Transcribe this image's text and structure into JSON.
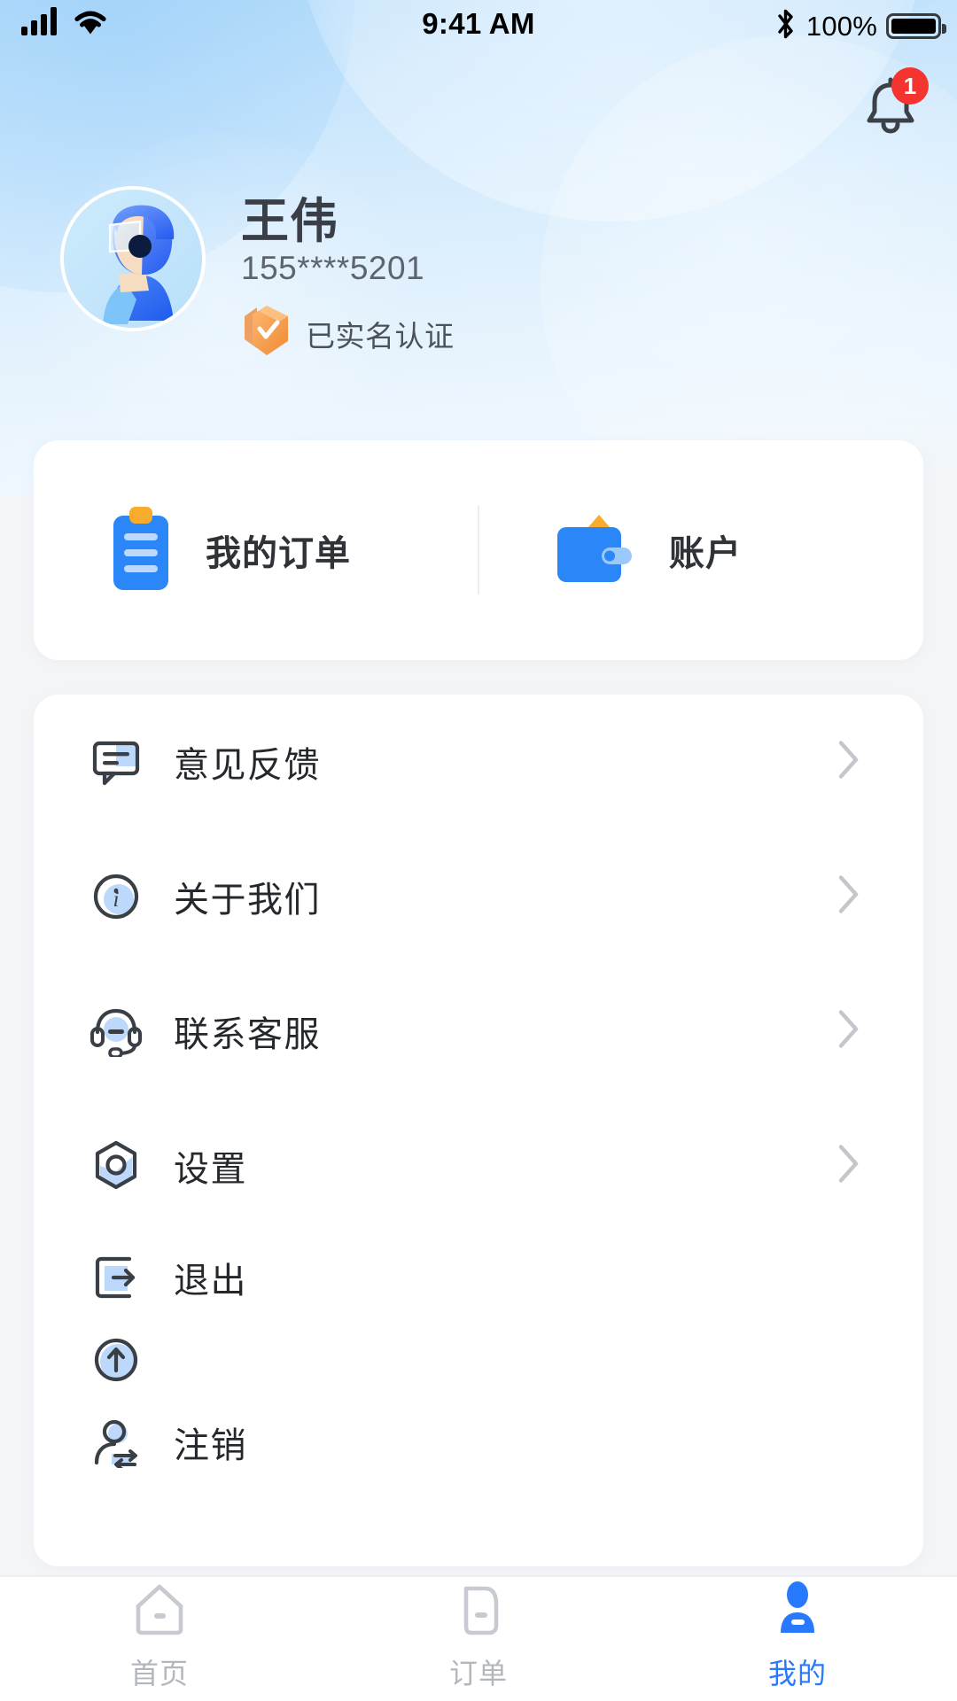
{
  "statusbar": {
    "time": "9:41 AM",
    "battery_percent": "100%",
    "signal_icon": "cellular-signal-icon",
    "wifi_icon": "wifi-icon",
    "bluetooth_icon": "bluetooth-icon",
    "battery_icon": "battery-full-icon"
  },
  "header": {
    "notification_icon": "bell-icon",
    "notification_count": "1"
  },
  "profile": {
    "avatar_icon": "rider-avatar",
    "name": "王伟",
    "phone": "155****5201",
    "verify_icon": "shield-check-icon",
    "verify_text": "已实名认证"
  },
  "quick_actions": [
    {
      "icon": "clipboard-order-icon",
      "label": "我的订单"
    },
    {
      "icon": "wallet-icon",
      "label": "账户"
    }
  ],
  "menu": [
    {
      "icon": "feedback-bubble-icon",
      "label": "意见反馈",
      "chevron": true
    },
    {
      "icon": "info-circle-icon",
      "label": "关于我们",
      "chevron": true
    },
    {
      "icon": "headset-support-icon",
      "label": "联系客服",
      "chevron": true
    },
    {
      "icon": "settings-hexagon-icon",
      "label": "设置",
      "chevron": true
    },
    {
      "icon": "logout-icon",
      "label": "退出",
      "chevron": false
    },
    {
      "icon": "arrow-up-circle-icon",
      "label": "",
      "chevron": false
    },
    {
      "icon": "account-deregister-icon",
      "label": "注销",
      "chevron": false
    }
  ],
  "tabs": [
    {
      "icon": "home-icon",
      "label": "首页",
      "active": false
    },
    {
      "icon": "order-doc-icon",
      "label": "订单",
      "active": false
    },
    {
      "icon": "person-icon",
      "label": "我的",
      "active": true
    }
  ],
  "colors": {
    "accent": "#2979ff",
    "badge": "#f5332f",
    "verify": "#f5a623",
    "tab_inactive": "#b3b7bd",
    "page_bg": "#f4f5f7",
    "card_bg": "#ffffff"
  }
}
